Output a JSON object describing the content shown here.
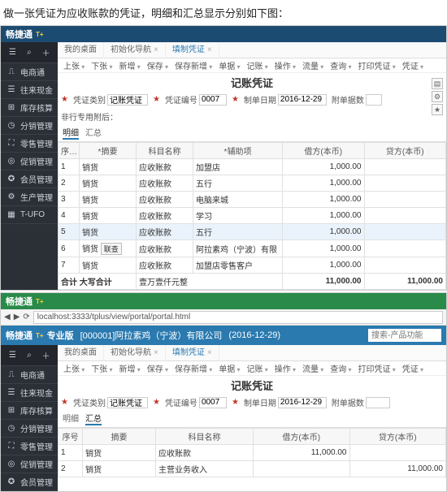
{
  "intro_text": "做一张凭证为应收账款的凭证，明细和汇总显示分别如下图：",
  "app1": {
    "titlebar": {
      "brand": "畅捷通",
      "brand_sup": "T+"
    },
    "sidebar": {
      "top_icons": [
        "menu",
        "search",
        "plus"
      ],
      "items": [
        {
          "icon": "⎍",
          "label": "电商通"
        },
        {
          "icon": "☰",
          "label": "往来现金"
        },
        {
          "icon": "⊞",
          "label": "库存核算"
        },
        {
          "icon": "◷",
          "label": "分销管理"
        },
        {
          "icon": "⛶",
          "label": "零售管理"
        },
        {
          "icon": "◎",
          "label": "促销管理"
        },
        {
          "icon": "✪",
          "label": "会员管理"
        },
        {
          "icon": "⚙",
          "label": "生产管理"
        },
        {
          "icon": "▦",
          "label": "T-UFO"
        }
      ]
    },
    "tabs": [
      {
        "label": "我的桌面",
        "closable": false
      },
      {
        "label": "初始化导航",
        "closable": true
      },
      {
        "label": "填制凭证",
        "closable": true,
        "active": true
      }
    ],
    "toolbar": [
      "上张",
      "下张",
      "新增",
      "保存",
      "保存新增",
      "单据",
      "记账",
      "操作",
      "流量",
      "查询",
      "打印凭证",
      "凭证"
    ],
    "doc_title": "记账凭证",
    "meta": {
      "type_label": "凭证类别",
      "type_value": "记账凭证",
      "no_label": "凭证编号",
      "no_value": "0007",
      "date_label": "制单日期",
      "date_value": "2016-12-29",
      "att_label": "附单据数",
      "att_value": "",
      "special_label": "非行专用附后："
    },
    "subtabs": {
      "detail": "明细",
      "summary": "汇总",
      "active": "detail"
    },
    "grid": {
      "headers": [
        "序号",
        "*摘要",
        "科目名称",
        "*辅助项",
        "借方(本币)",
        "贷方(本币)"
      ],
      "rows": [
        {
          "idx": "1",
          "sum": "销货",
          "acct": "应收账款",
          "aux": "加盟店",
          "debit": "1,000.00",
          "credit": ""
        },
        {
          "idx": "2",
          "sum": "销货",
          "acct": "应收账款",
          "aux": "五行",
          "debit": "1,000.00",
          "credit": ""
        },
        {
          "idx": "3",
          "sum": "销货",
          "acct": "应收账款",
          "aux": "电脑来城",
          "debit": "1,000.00",
          "credit": ""
        },
        {
          "idx": "4",
          "sum": "销货",
          "acct": "应收账款",
          "aux": "学习",
          "debit": "1,000.00",
          "credit": ""
        },
        {
          "idx": "5",
          "sum": "销货",
          "acct": "应收账款",
          "aux": "五行",
          "debit": "1,000.00",
          "credit": "",
          "selected": true
        },
        {
          "idx": "6",
          "sum": "销货",
          "acct": "应收账款",
          "aux": "阿拉素鸡（宁波）有限",
          "debit": "1,000.00",
          "credit": "",
          "btn": "联查"
        },
        {
          "idx": "7",
          "sum": "销货",
          "acct": "应收账款",
          "aux": "加盟店零售客户",
          "debit": "1,000.00",
          "credit": ""
        }
      ],
      "total": {
        "label": "合计 大写合计",
        "words": "壹万壹仟元整",
        "debit": "11,000.00",
        "credit": "11,000.00"
      }
    }
  },
  "app2": {
    "titlebar": {
      "brand": "畅捷通",
      "brand_sup": "T+"
    },
    "url": "localhost:3333/tplus/view/portal/portal.html",
    "header": {
      "brand": "畅捷通",
      "brand_sup": "T+",
      "edition": "专业版",
      "org": "[000001]阿拉素鸡（宁波）有限公司",
      "date": "(2016-12-29)",
      "search_placeholder": "搜索-产品功能"
    },
    "sidebar": {
      "top_icons": [
        "menu",
        "search",
        "plus"
      ],
      "items": [
        {
          "icon": "⎍",
          "label": "电商通"
        },
        {
          "icon": "☰",
          "label": "往来现金"
        },
        {
          "icon": "⊞",
          "label": "库存核算"
        },
        {
          "icon": "◷",
          "label": "分销管理"
        },
        {
          "icon": "⛶",
          "label": "零售管理"
        },
        {
          "icon": "◎",
          "label": "促销管理"
        },
        {
          "icon": "✪",
          "label": "会员管理"
        }
      ]
    },
    "tabs": [
      {
        "label": "我的桌面",
        "closable": false
      },
      {
        "label": "初始化导航",
        "closable": true
      },
      {
        "label": "填制凭证",
        "closable": true,
        "active": true
      }
    ],
    "toolbar": [
      "上张",
      "下张",
      "新增",
      "保存",
      "保存新增",
      "单据",
      "记账",
      "操作",
      "流量",
      "查询",
      "打印凭证",
      "凭证"
    ],
    "doc_title": "记账凭证",
    "meta": {
      "type_label": "凭证类别",
      "type_value": "记账凭证",
      "no_label": "凭证编号",
      "no_value": "0007",
      "date_label": "制单日期",
      "date_value": "2016-12-29",
      "att_label": "附单据数",
      "att_value": ""
    },
    "subtabs": {
      "detail": "明细",
      "summary": "汇总",
      "active": "summary"
    },
    "grid": {
      "headers": [
        "序号",
        "摘要",
        "科目名称",
        "借方(本币)",
        "贷方(本币)"
      ],
      "rows": [
        {
          "idx": "1",
          "sum": "销货",
          "acct": "应收账款",
          "debit": "11,000.00",
          "credit": ""
        },
        {
          "idx": "2",
          "sum": "销货",
          "acct": "主营业务收入",
          "debit": "",
          "credit": "11,000.00"
        }
      ]
    }
  }
}
